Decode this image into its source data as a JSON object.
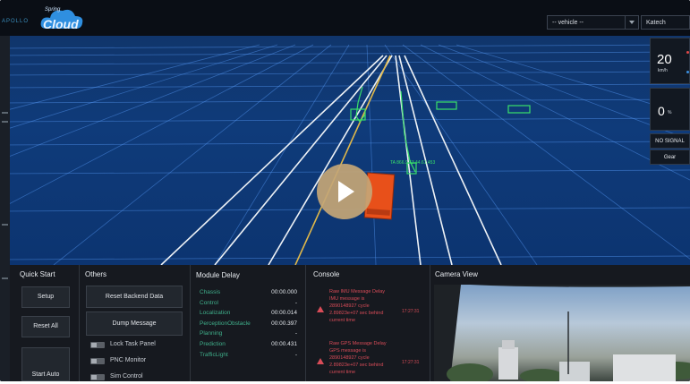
{
  "header": {
    "brand_text": "APOLLO",
    "logo_small": "Spring",
    "logo_big": "Cloud",
    "vehicle_select": "-- vehicle --",
    "map_select": "Katech"
  },
  "hud": {
    "speed_value": "20",
    "speed_unit": "km/h",
    "throttle_value": "0",
    "throttle_unit": "%",
    "signal_text": "NO SIGNAL",
    "gear_label": "Gear"
  },
  "scene": {
    "obstacle_label": "TA 866.9.43.44.61.453",
    "colors": {
      "ground": "#0f3b7a",
      "grid": "#5aa0ff",
      "lane": "#e6e9ee",
      "center": "#e0b84a",
      "ego": "#e8501a",
      "obstacle": "#39e06a"
    }
  },
  "quick_start": {
    "title": "Quick Start",
    "setup": "Setup",
    "reset_all": "Reset All",
    "start_auto": "Start Auto"
  },
  "others": {
    "title": "Others",
    "reset_backend": "Reset Backend Data",
    "dump_message": "Dump Message",
    "toggles": [
      "Lock Task Panel",
      "PNC Monitor",
      "Sim Control"
    ]
  },
  "module_delay": {
    "title": "Module Delay",
    "rows": [
      {
        "name": "Chassis",
        "value": "00:00.000"
      },
      {
        "name": "Control",
        "value": "-"
      },
      {
        "name": "Localization",
        "value": "00:00.014"
      },
      {
        "name": "PerceptionObstacle",
        "value": "00:00.397"
      },
      {
        "name": "Planning",
        "value": "-"
      },
      {
        "name": "Prediction",
        "value": "00:00.431"
      },
      {
        "name": "TrafficLight",
        "value": "-"
      }
    ]
  },
  "console": {
    "title": "Console",
    "messages": [
      {
        "lines": [
          "Raw IMU Message Delay",
          "IMU message is",
          "2890148927 cycle",
          "2.89823e+07 sec behind",
          "current time"
        ],
        "time": "17:27:31"
      },
      {
        "lines": [
          "Raw GPS Message Delay",
          "GPS message is",
          "2890148927 cycle",
          "2.89823e+07 sec behind",
          "current time"
        ],
        "time": "17:27:31"
      }
    ]
  },
  "camera": {
    "title": "Camera View"
  }
}
